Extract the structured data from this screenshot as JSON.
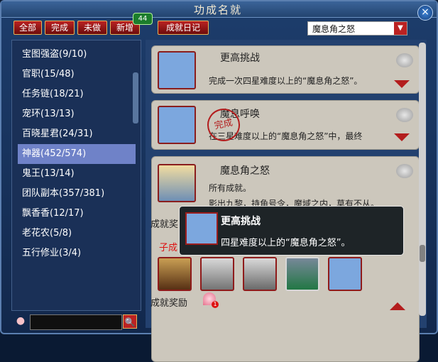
{
  "window": {
    "title": "功成名就",
    "close_label": "×"
  },
  "tabs": {
    "all": "全部",
    "done": "完成",
    "undone": "未做",
    "new": "新增",
    "new_count": "44",
    "diary": "成就日记"
  },
  "filter": {
    "selected": "魔息角之怒"
  },
  "sidebar": {
    "items": [
      {
        "label": "宝图强盗(9/10)"
      },
      {
        "label": "官职(15/48)"
      },
      {
        "label": "任务链(18/21)"
      },
      {
        "label": "宠环(13/13)"
      },
      {
        "label": "百晓星君(24/31)"
      },
      {
        "label": "神器(452/574)",
        "active": true
      },
      {
        "label": "鬼王(13/14)"
      },
      {
        "label": "团队副本(357/381)"
      },
      {
        "label": "飘香香(12/17)"
      },
      {
        "label": "老花农(5/8)"
      },
      {
        "label": "五行修业(3/4)"
      }
    ]
  },
  "search": {
    "value": "",
    "search_label": "🔍"
  },
  "cards": [
    {
      "title": "更高挑战",
      "desc": "完成一次四星难度以上的“魔息角之怒”。"
    },
    {
      "title": "魔息呼唤",
      "desc": "在三星难度以上的“魔息角之怒”中，最终",
      "stamp": "完成"
    },
    {
      "title": "魔息角之怒",
      "desc": "所有成就。",
      "desc2": "影出九黎，持角号令，魔域之内，莫有不从。"
    }
  ],
  "details": {
    "left_label": "成就奖",
    "sub_label": "子成",
    "reward_label": "成就奖励",
    "reward_count": "1"
  },
  "tooltip": {
    "title": "更高挑战",
    "desc": "四星难度以上的“魔息角之怒”。"
  }
}
